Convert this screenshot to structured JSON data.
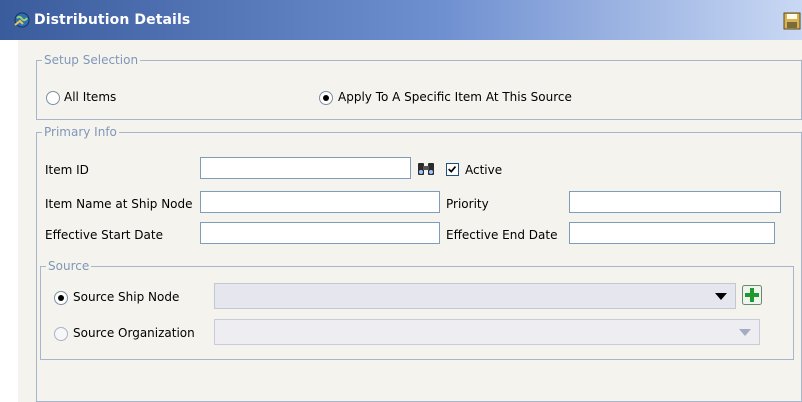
{
  "window": {
    "title": "Distribution Details"
  },
  "setup_selection": {
    "legend": "Setup Selection",
    "options": [
      {
        "label": "All Items",
        "selected": false
      },
      {
        "label": "Apply To A Specific Item At This Source",
        "selected": true
      }
    ]
  },
  "primary_info": {
    "legend": "Primary Info",
    "item_id": {
      "label": "Item ID",
      "value": ""
    },
    "active": {
      "label": "Active",
      "checked": true
    },
    "item_name_at_ship_node": {
      "label": "Item Name at Ship Node",
      "value": ""
    },
    "priority": {
      "label": "Priority",
      "value": ""
    },
    "effective_start_date": {
      "label": "Effective Start Date",
      "value": ""
    },
    "effective_end_date": {
      "label": "Effective End Date",
      "value": ""
    }
  },
  "source": {
    "legend": "Source",
    "ship_node": {
      "label": "Source Ship Node",
      "selected": true,
      "value": ""
    },
    "organization": {
      "label": "Source Organization",
      "selected": false,
      "value": ""
    }
  },
  "colors": {
    "title_bar_start": "#3a5b9c",
    "title_bar_end": "#c9d8f4",
    "panel_bg": "#f4f3ee",
    "legend_text": "#7f97b8",
    "add_button": "#1f9a2f"
  }
}
